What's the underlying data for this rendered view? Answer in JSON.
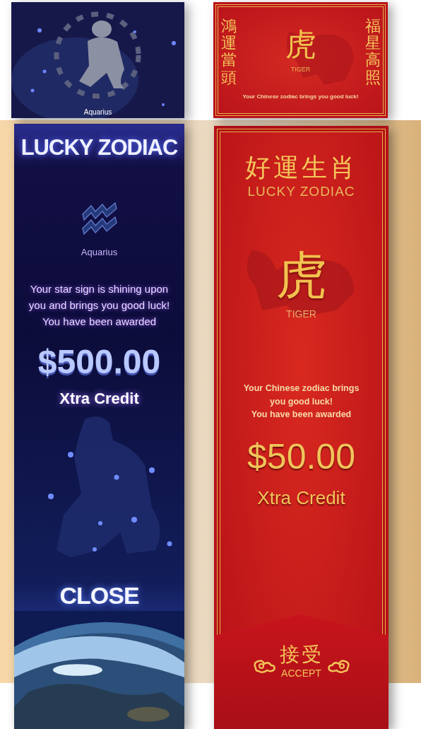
{
  "top_banners": {
    "star_sign": {
      "sign_label": "Aquarius"
    },
    "chinese": {
      "left_couplet": "鴻運當頭",
      "right_couplet": "福星高照",
      "character": "虎",
      "animal": "TIGER",
      "message": "Your Chinese zodiac brings you good luck!"
    }
  },
  "star_sign_popup": {
    "title": "LUCKY ZODIAC",
    "sign": "Aquarius",
    "message_lines": [
      "Your star sign is shining upon",
      "you and brings you good luck!",
      "You have been awarded"
    ],
    "amount": "$500.00",
    "credit_label": "Xtra Credit",
    "close_button": "CLOSE"
  },
  "chinese_popup": {
    "title_chinese": "好運生肖",
    "title": "LUCKY ZODIAC",
    "character": "虎",
    "animal": "TIGER",
    "message_lines": [
      "Your Chinese zodiac brings",
      "you good luck!",
      "You have been awarded"
    ],
    "amount": "$50.00",
    "credit_label": "Xtra Credit",
    "accept_button": {
      "chinese": "接受",
      "label": "ACCEPT"
    }
  }
}
